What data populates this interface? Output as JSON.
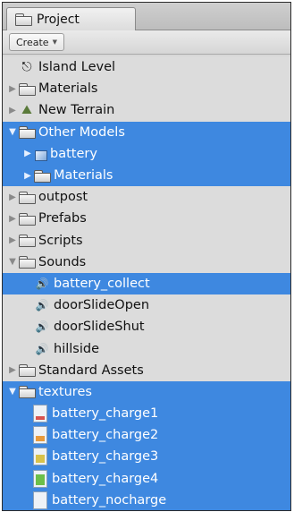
{
  "tab": {
    "label": "Project"
  },
  "toolbar": {
    "create_label": "Create"
  },
  "tree": [
    {
      "label": "Island Level",
      "icon": "scene-icon",
      "indent": 0,
      "arrow": "",
      "selected": false
    },
    {
      "label": "Materials",
      "icon": "folder-icon",
      "indent": 0,
      "arrow": "right",
      "selected": false
    },
    {
      "label": "New Terrain",
      "icon": "terrain-icon",
      "indent": 0,
      "arrow": "right",
      "selected": false
    },
    {
      "label": "Other Models",
      "icon": "folder-icon",
      "indent": 0,
      "arrow": "down",
      "selected": true
    },
    {
      "label": "battery",
      "icon": "model-icon",
      "indent": 1,
      "arrow": "right",
      "selected": true
    },
    {
      "label": "Materials",
      "icon": "folder-icon",
      "indent": 1,
      "arrow": "right",
      "selected": true
    },
    {
      "label": "outpost",
      "icon": "folder-icon",
      "indent": 0,
      "arrow": "right",
      "selected": false
    },
    {
      "label": "Prefabs",
      "icon": "folder-icon",
      "indent": 0,
      "arrow": "right",
      "selected": false
    },
    {
      "label": "Scripts",
      "icon": "folder-icon",
      "indent": 0,
      "arrow": "right",
      "selected": false
    },
    {
      "label": "Sounds",
      "icon": "folder-icon",
      "indent": 0,
      "arrow": "down",
      "selected": false
    },
    {
      "label": "battery_collect",
      "icon": "sound-icon",
      "indent": 1,
      "arrow": "",
      "selected": true
    },
    {
      "label": "doorSlideOpen",
      "icon": "sound-icon",
      "indent": 1,
      "arrow": "",
      "selected": false
    },
    {
      "label": "doorSlideShut",
      "icon": "sound-icon",
      "indent": 1,
      "arrow": "",
      "selected": false
    },
    {
      "label": "hillside",
      "icon": "sound-icon",
      "indent": 1,
      "arrow": "",
      "selected": false
    },
    {
      "label": "Standard Assets",
      "icon": "folder-icon",
      "indent": 0,
      "arrow": "right",
      "selected": false
    },
    {
      "label": "textures",
      "icon": "folder-icon",
      "indent": 0,
      "arrow": "down",
      "selected": true
    },
    {
      "label": "battery_charge1",
      "icon": "texture-icon",
      "indent": 1,
      "arrow": "",
      "selected": true,
      "charge": 0.25,
      "charge_color": "#d9534f"
    },
    {
      "label": "battery_charge2",
      "icon": "texture-icon",
      "indent": 1,
      "arrow": "",
      "selected": true,
      "charge": 0.45,
      "charge_color": "#e89a3c"
    },
    {
      "label": "battery_charge3",
      "icon": "texture-icon",
      "indent": 1,
      "arrow": "",
      "selected": true,
      "charge": 0.65,
      "charge_color": "#d8c24a"
    },
    {
      "label": "battery_charge4",
      "icon": "texture-icon",
      "indent": 1,
      "arrow": "",
      "selected": true,
      "charge": 0.85,
      "charge_color": "#6cbf4a"
    },
    {
      "label": "battery_nocharge",
      "icon": "texture-icon",
      "indent": 1,
      "arrow": "",
      "selected": true,
      "charge": 0,
      "charge_color": "#cccccc"
    }
  ]
}
